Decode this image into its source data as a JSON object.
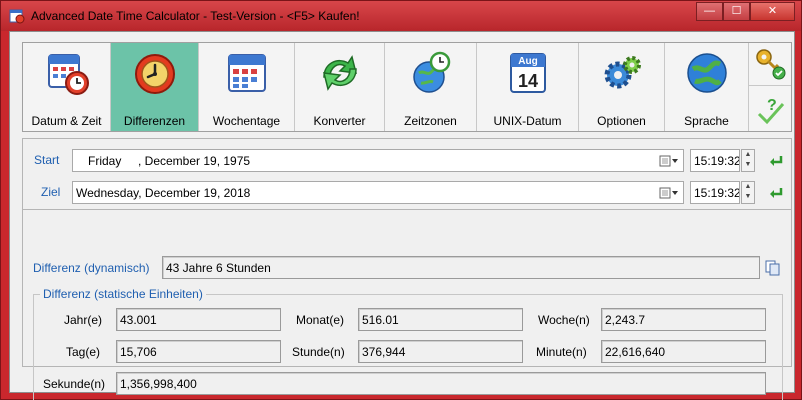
{
  "window": {
    "title": "Advanced Date Time Calculator - Test-Version - <F5> Kaufen!",
    "minimize": "—",
    "maximize": "☐",
    "close": "✕"
  },
  "toolbar": {
    "items": [
      {
        "label": "Datum & Zeit",
        "icon": "calendar-clock-icon"
      },
      {
        "label": "Differenzen",
        "icon": "alarm-clock-icon",
        "active": true
      },
      {
        "label": "Wochentage",
        "icon": "calendar-icon"
      },
      {
        "label": "Konverter",
        "icon": "convert-arrows-icon"
      },
      {
        "label": "Zeitzonen",
        "icon": "globe-clock-icon"
      },
      {
        "label": "UNIX-Datum",
        "icon": "calendar-date-icon",
        "month": "Aug",
        "day": "14"
      },
      {
        "label": "Optionen",
        "icon": "gears-icon"
      },
      {
        "label": "Sprache",
        "icon": "globe-icon"
      }
    ],
    "side": [
      "keys-icon",
      "help-icon"
    ]
  },
  "start": {
    "label": "Start",
    "weekday": "Friday",
    "date": ", December 19, 1975",
    "time": "15:19:32"
  },
  "ziel": {
    "label": "Ziel",
    "date": "Wednesday, December 19, 2018",
    "time": "15:19:32"
  },
  "dynamic": {
    "label": "Differenz (dynamisch)",
    "value": "43 Jahre 6 Stunden"
  },
  "static": {
    "legend": "Differenz (statische Einheiten)",
    "jahr_label": "Jahr(e)",
    "jahr": "43.001",
    "monat_label": "Monat(e)",
    "monat": "516.01",
    "woche_label": "Woche(n)",
    "woche": "2,243.7",
    "tag_label": "Tag(e)",
    "tag": "15,706",
    "stunde_label": "Stunde(n)",
    "stunde": "376,944",
    "minute_label": "Minute(n)",
    "minute": "22,616,640",
    "sekunde_label": "Sekunde(n)",
    "sekunde": "1,356,998,400"
  },
  "colors": {
    "titlebar": "#c9272d",
    "active_tab": "#6cc3a8",
    "link_blue": "#1f5fb0"
  }
}
